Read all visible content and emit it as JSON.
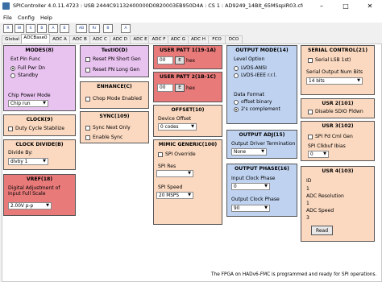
{
  "window": {
    "title": "SPIController 4.0.11.4723 : USB 2444C91132400000D0820003EB950D4A : CS 1 : AD9249_14Bit_65MSspiR03.cfg : AD9249_14Bit_65MSspiR03.cfg : AD9249_14Bit_65MSs..."
  },
  "menu": {
    "items": [
      "File",
      "Config",
      "Help"
    ]
  },
  "toolbar": {
    "buttons": [
      "R",
      "W",
      "S",
      "B",
      "A",
      "B",
      "AB",
      "Rr",
      "B",
      "A"
    ]
  },
  "tabs": [
    "Global",
    "ADCBase0",
    "ADC A",
    "ADC B",
    "ADC C",
    "ADC D",
    "ADC E",
    "ADC F",
    "ADC G",
    "ADC H",
    "FCO",
    "DCO"
  ],
  "modes": {
    "title": "MODES(8)",
    "ext_pin_func_label": "Ext Pin Func",
    "full_pwr_label": "Full Pwr Dn",
    "standby_label": "Standby",
    "chip_power_mode_label": "Chip Power Mode",
    "chip_power_mode_value": "Chip run"
  },
  "test_io": {
    "title": "TestIO(D)",
    "reset_pn_short": "Reset PN Short Gen",
    "reset_pn_long": "Reset PN Long Gen"
  },
  "user_patt1": {
    "title": "USER PATT 1(19-1A)",
    "value": "00",
    "unit": "hex",
    "e_label": "E"
  },
  "user_patt2": {
    "title": "USER PATT 2(1B-1C)",
    "value": "00",
    "unit": "hex",
    "e_label": "E"
  },
  "output_mode": {
    "title": "OUTPUT MODE(14)",
    "level_option_label": "Level Option",
    "lvds_ansi": "LVDS-ANSI",
    "lvds_ieee": "LVDS-IEEE r.r.l.",
    "data_format_label": "Data Format",
    "offset_binary": "offset binary",
    "twos_complement": "2's complement"
  },
  "serial_control": {
    "title": "SERIAL CONTROL(21)",
    "serial_lsb_first": "Serial LSB 1st)",
    "output_num_bits_label": "Serial Output Num Bits",
    "output_num_bits_value": "14 bits"
  },
  "clock": {
    "title": "CLOCK(9)",
    "duty_cycle_stabilize": "Duty Cycle Stabilize"
  },
  "enhance": {
    "title": "ENHANCE(C)",
    "chop_mode_enabled": "Chop Mode Enabled"
  },
  "offset": {
    "title": "OFFSET(10)",
    "device_offset_label": "Device Offset",
    "device_offset_value": "0 codes"
  },
  "usr2": {
    "title": "USR 2(101)",
    "disable_sdio_pldwn": "Disable SDIO Pldwn"
  },
  "clock_divide": {
    "title": "CLOCK DIVIDE(B)",
    "divide_by_label": "Divide By:",
    "divide_by_value": "divby 1"
  },
  "sync": {
    "title": "SYNC(109)",
    "sync_next_only": "Sync Next Only",
    "enable_sync": "Enable Sync"
  },
  "mimic_generic": {
    "title": "MIMIC GENERIC(100)",
    "spi_override": "SPI Override",
    "spi_res_label": "SPI Res",
    "spi_speed_label": "SPI Speed",
    "spi_speed_value": "20 MSPS"
  },
  "output_adj": {
    "title": "OUTPUT ADJ(15)",
    "driver_termination_label": "Output Driver Termination",
    "driver_termination_value": "None"
  },
  "usr3": {
    "title": "USR 3(102)",
    "spi_pd_cml_gen": "SPI Pd Cml Gen",
    "spi_clkbuf_ibias": "SPI Clkbuf Ibias",
    "spi_clkbuf_value": "0"
  },
  "vref": {
    "title": "VREF(18)",
    "digital_adjustment_label": "Digital Adjustment of Input Full Scale",
    "value": "2.00V p-p"
  },
  "output_phase": {
    "title": "OUTPUT PHASE(16)",
    "input_clock_phase_label": "Input Clock Phase",
    "input_clock_phase_value": "0",
    "output_clock_phase_label": "Output Clock Phase",
    "output_clock_phase_value": "90"
  },
  "usr4": {
    "title": "USR 4(103)",
    "id_label": "ID",
    "id_value": "1",
    "adc_resolution_label": "ADC Resolution",
    "adc_resolution_value": "1",
    "adc_speed_label": "ADC Speed",
    "adc_speed_value": "3",
    "read_button": "Read"
  },
  "status": {
    "text": "The FPGA on HADv6-FMC is programmed and ready for SPI operations."
  },
  "colors": {
    "violet": "#e9c3f0",
    "red": "#e87a7a",
    "peach": "#fbd9c0",
    "blue": "#bfd3f1"
  }
}
